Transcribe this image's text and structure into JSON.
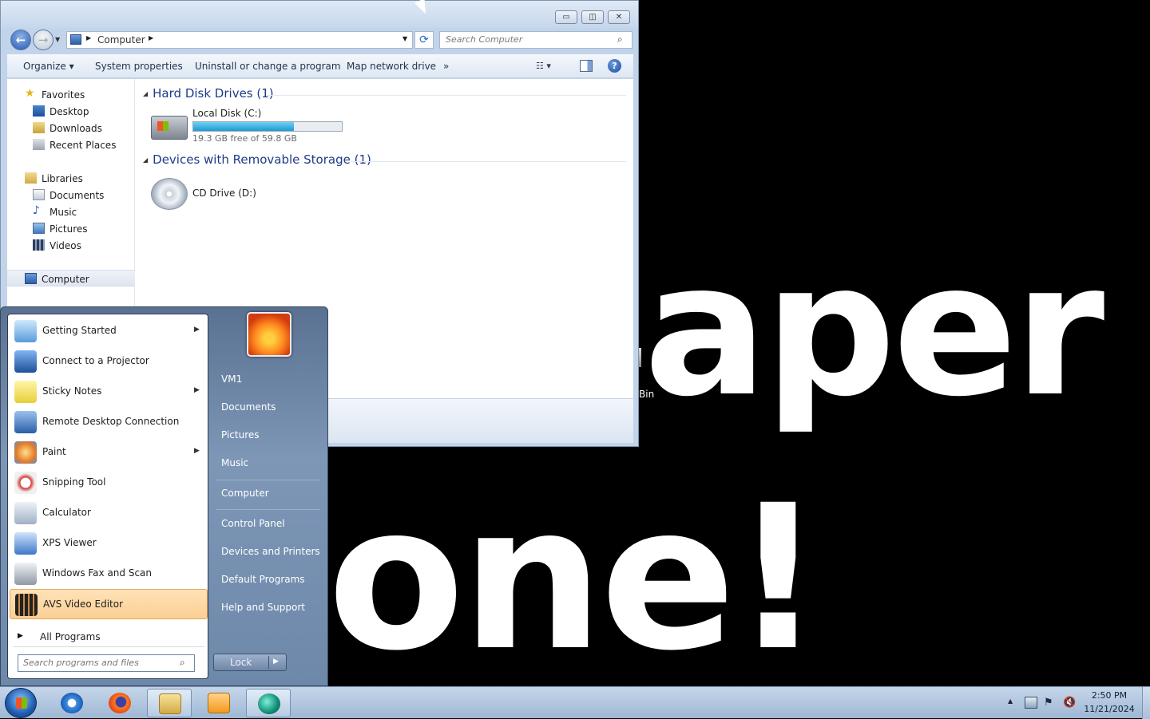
{
  "desktop": {
    "wallpaper_line1": "aper",
    "wallpaper_line2": "one!",
    "recycle_bin_label": "Bin"
  },
  "explorer": {
    "address_path": "Computer",
    "search_placeholder": "Search Computer",
    "toolbar": {
      "organize": "Organize",
      "system_properties": "System properties",
      "uninstall": "Uninstall or change a program",
      "map_drive": "Map network drive",
      "more": "»"
    },
    "nav": {
      "favorites": "Favorites",
      "desktop": "Desktop",
      "downloads": "Downloads",
      "recent_places": "Recent Places",
      "libraries": "Libraries",
      "documents": "Documents",
      "music": "Music",
      "pictures": "Pictures",
      "videos": "Videos",
      "computer": "Computer"
    },
    "groups": {
      "hard_disk": "Hard Disk Drives (1)",
      "removable": "Devices with Removable Storage (1)"
    },
    "drives": {
      "c_name": "Local Disk (C:)",
      "c_free_text": "19.3 GB free of 59.8 GB",
      "c_used_fraction": 0.68,
      "d_name": "CD Drive (D:)"
    }
  },
  "start_menu": {
    "programs": [
      {
        "label": "Getting Started",
        "has_arrow": true,
        "icon": "getting-started-icon"
      },
      {
        "label": "Connect to a Projector",
        "has_arrow": false,
        "icon": "projector-icon"
      },
      {
        "label": "Sticky Notes",
        "has_arrow": true,
        "icon": "sticky-notes-icon"
      },
      {
        "label": "Remote Desktop Connection",
        "has_arrow": false,
        "icon": "remote-desktop-icon"
      },
      {
        "label": "Paint",
        "has_arrow": true,
        "icon": "paint-icon"
      },
      {
        "label": "Snipping Tool",
        "has_arrow": false,
        "icon": "snipping-tool-icon"
      },
      {
        "label": "Calculator",
        "has_arrow": false,
        "icon": "calculator-icon"
      },
      {
        "label": "XPS Viewer",
        "has_arrow": false,
        "icon": "xps-viewer-icon"
      },
      {
        "label": "Windows Fax and Scan",
        "has_arrow": false,
        "icon": "fax-scan-icon"
      },
      {
        "label": "AVS Video Editor",
        "has_arrow": false,
        "icon": "avs-video-editor-icon"
      }
    ],
    "all_programs": "All Programs",
    "search_placeholder": "Search programs and files",
    "right_links": {
      "user": "VM1",
      "documents": "Documents",
      "pictures": "Pictures",
      "music": "Music",
      "computer": "Computer",
      "control_panel": "Control Panel",
      "devices": "Devices and Printers",
      "default_programs": "Default Programs",
      "help": "Help and Support"
    },
    "lock_label": "Lock"
  },
  "taskbar": {
    "time": "2:50 PM",
    "date": "11/21/2024"
  }
}
